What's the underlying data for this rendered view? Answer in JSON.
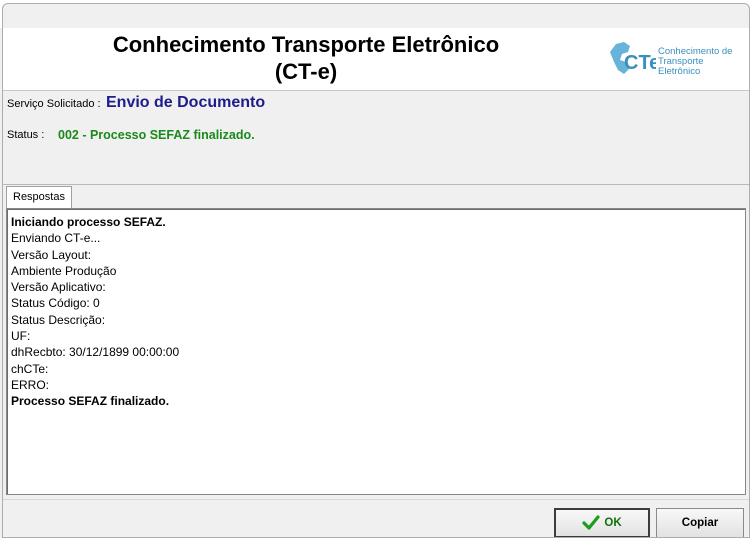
{
  "header": {
    "title_line1": "Conhecimento Transporte Eletrônico",
    "title_line2": "(CT-e)",
    "logo_mark": "CTe",
    "logo_line1": "Conhecimento de",
    "logo_line2": "Transporte Eletrônico"
  },
  "service": {
    "label": "Serviço Solicitado :",
    "value": "Envio de Documento"
  },
  "status": {
    "label": "Status :",
    "value": "002 - Processo SEFAZ finalizado."
  },
  "tab": {
    "label": "Respostas"
  },
  "log": [
    "Iniciando processo SEFAZ.",
    "Enviando CT-e...",
    "Versão Layout:",
    "Ambiente Produção",
    "Versão Aplicativo:",
    "Status Código: 0",
    "Status Descrição:",
    "UF:",
    "dhRecbto: 30/12/1899 00:00:00",
    "chCTe:",
    "ERRO:",
    "Processo SEFAZ finalizado."
  ],
  "buttons": {
    "ok": "OK",
    "copy": "Copiar"
  },
  "colors": {
    "service_value": "#1c1c8c",
    "status_value": "#1a8a1a",
    "logo": "#3a8fc0",
    "ok_check": "#1c9c1c"
  },
  "icons": {
    "ok": "check-icon",
    "logo": "cte-brazil-map-logo"
  }
}
